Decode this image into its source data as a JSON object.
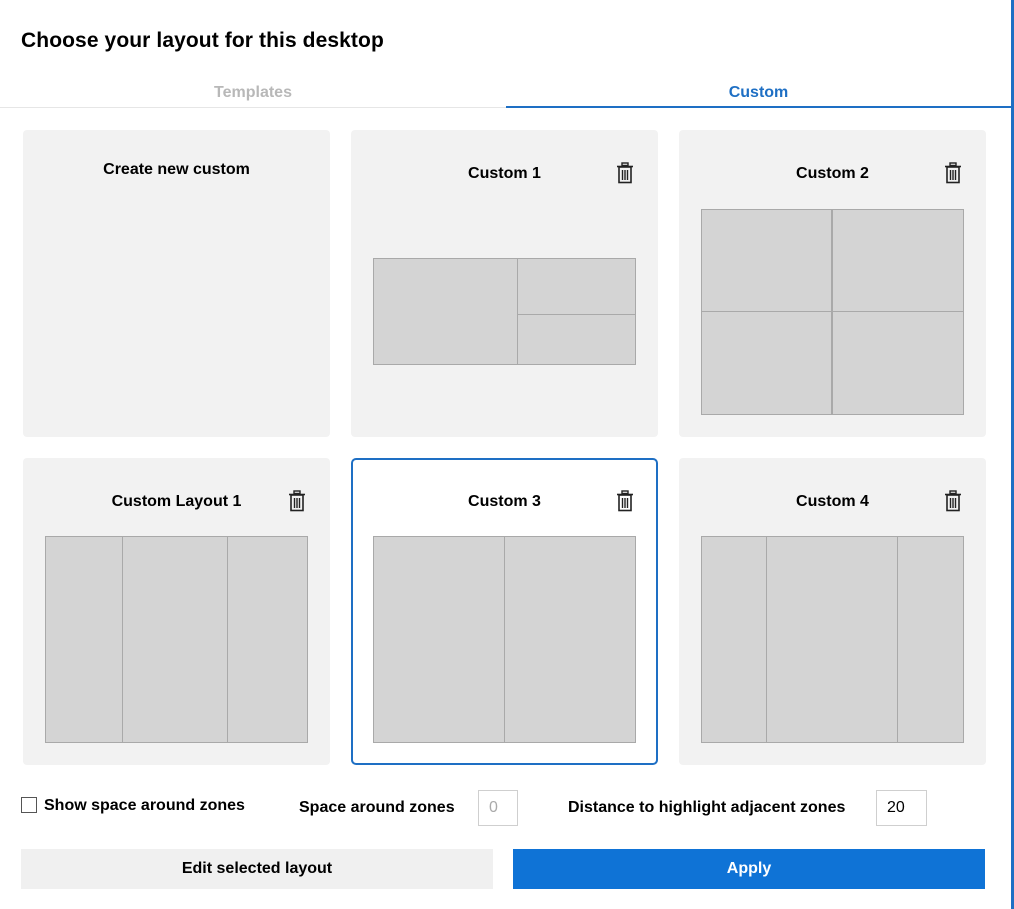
{
  "dialog": {
    "title": "Choose your layout for this desktop"
  },
  "tabs": [
    {
      "label": "Templates",
      "active": false
    },
    {
      "label": "Custom",
      "active": true
    }
  ],
  "cards": [
    {
      "title": "Create new custom"
    },
    {
      "title": "Custom 1",
      "icon": "trash-icon"
    },
    {
      "title": "Custom 2",
      "icon": "trash-icon"
    },
    {
      "title": "Custom Layout 1",
      "icon": "trash-icon"
    },
    {
      "title": "Custom 3",
      "icon": "trash-icon",
      "selected": true
    },
    {
      "title": "Custom 4",
      "icon": "trash-icon"
    }
  ],
  "settings": {
    "show_space_label": "Show space around zones",
    "show_space_checked": false,
    "space_label": "Space around zones",
    "space_value": "0",
    "distance_label": "Distance to highlight adjacent zones",
    "distance_value": "20"
  },
  "buttons": {
    "edit_label": "Edit selected layout",
    "apply_label": "Apply"
  },
  "colors": {
    "accent": "#1e6fc4",
    "apply_bg": "#0f73d6",
    "card_bg": "#f2f2f2",
    "zone_bg": "#d4d4d4"
  }
}
